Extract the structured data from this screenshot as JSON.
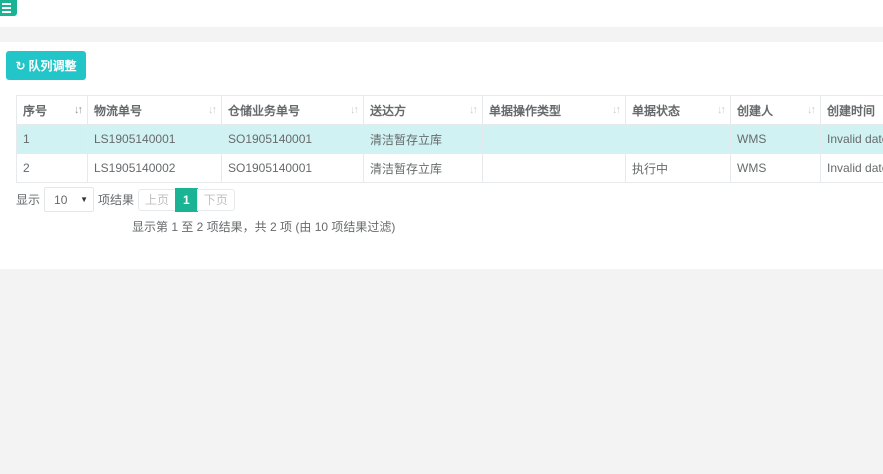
{
  "toolbar": {
    "menu_icon": "hamburger-icon",
    "queue_button_icon": "refresh-icon",
    "queue_button_label": "队列调整"
  },
  "table": {
    "columns": [
      "序号",
      "物流单号",
      "仓储业务单号",
      "送达方",
      "单据操作类型",
      "单据状态",
      "创建人",
      "创建时间"
    ],
    "rows": [
      [
        "1",
        "LS1905140001",
        "SO1905140001",
        "清洁暂存立库",
        "",
        "",
        "WMS",
        "Invalid date"
      ],
      [
        "2",
        "LS1905140002",
        "SO1905140001",
        "清洁暂存立库",
        "",
        "执行中",
        "WMS",
        "Invalid date"
      ]
    ]
  },
  "pager": {
    "show_label": "显示",
    "page_size": "10",
    "results_label": "项结果",
    "prev_label": "上页",
    "current_page": "1",
    "next_label": "下页",
    "info_text": "显示第 1 至 2 项结果，共 2 项 (由 10 项结果过滤)"
  },
  "colors": {
    "accent": "#1ab394",
    "button": "#23c6c8",
    "selected_row": "#d1f2f2"
  }
}
